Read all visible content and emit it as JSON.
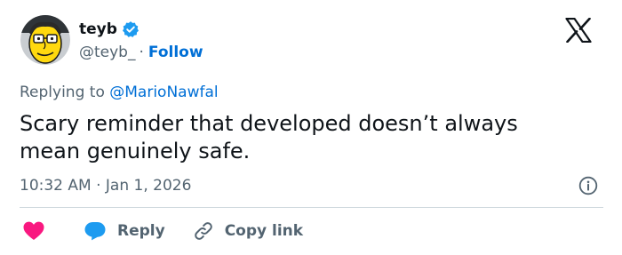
{
  "author": {
    "display_name": "teyb",
    "handle": "@teyb_",
    "separator": "·",
    "follow_label": "Follow",
    "avatar": "cartoon-face-avatar",
    "verified": true
  },
  "reply_context": {
    "prefix": "Replying to",
    "mention": "@MarioNawfal"
  },
  "tweet": {
    "text": "Scary reminder that developed doesn’t always mean genuinely safe.",
    "time": "10:32 AM",
    "separator": "·",
    "date": "Jan 1, 2026"
  },
  "actions": {
    "reply_label": "Reply",
    "copy_link_label": "Copy link"
  },
  "icons": {
    "brand": "x-logo-icon",
    "info": "info-icon",
    "like": "heart-icon",
    "reply": "speech-bubble-icon",
    "copy": "link-icon"
  },
  "colors": {
    "text": "#0f1419",
    "secondary": "#536471",
    "link": "#006fd6",
    "verified": "#1d9bf0",
    "heart": "#f91880",
    "divider": "#cfd9de"
  }
}
